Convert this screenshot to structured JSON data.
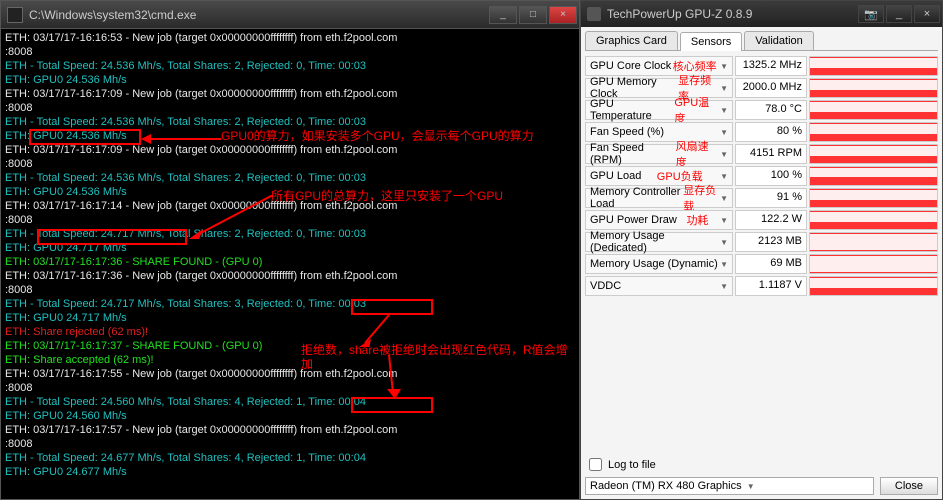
{
  "cmd": {
    "title": "C:\\Windows\\system32\\cmd.exe",
    "btn_min": "_",
    "btn_max": "□",
    "btn_close": "×",
    "lines": [
      {
        "cls": "t-white",
        "txt": "ETH: 03/17/17-16:16:53 - New job (target 0x00000000ffffffff) from eth.f2pool.com"
      },
      {
        "cls": "t-white",
        "txt": ":8008"
      },
      {
        "cls": "t-teal",
        "txt": "ETH - Total Speed: 24.536 Mh/s, Total Shares: 2, Rejected: 0, Time: 00:03"
      },
      {
        "cls": "t-teal",
        "txt": "ETH: GPU0 24.536 Mh/s"
      },
      {
        "cls": "t-white",
        "txt": "ETH: 03/17/17-16:17:09 - New job (target 0x00000000ffffffff) from eth.f2pool.com"
      },
      {
        "cls": "t-white",
        "txt": ":8008"
      },
      {
        "cls": "t-teal",
        "txt": "ETH - Total Speed: 24.536 Mh/s, Total Shares: 2, Rejected: 0, Time: 00:03"
      },
      {
        "cls": "t-teal",
        "txt": "ETH: GPU0 24.536 Mh/s"
      },
      {
        "cls": "t-white",
        "txt": "ETH: 03/17/17-16:17:09 - New job (target 0x00000000ffffffff) from eth.f2pool.com"
      },
      {
        "cls": "t-white",
        "txt": ":8008"
      },
      {
        "cls": "t-teal",
        "txt": "ETH - Total Speed: 24.536 Mh/s, Total Shares: 2, Rejected: 0, Time: 00:03"
      },
      {
        "cls": "t-teal",
        "txt": "ETH: GPU0 24.536 Mh/s"
      },
      {
        "cls": "t-white",
        "txt": "ETH: 03/17/17-16:17:14 - New job (target 0x00000000ffffffff) from eth.f2pool.com"
      },
      {
        "cls": "t-white",
        "txt": ":8008"
      },
      {
        "cls": "t-teal",
        "txt": "ETH - Total Speed: 24.717 Mh/s, Total Shares: 2, Rejected: 0, Time: 00:03"
      },
      {
        "cls": "t-teal",
        "txt": "ETH: GPU0 24.717 Mh/s"
      },
      {
        "cls": "t-green",
        "txt": "ETH: 03/17/17-16:17:36 - SHARE FOUND - (GPU 0)"
      },
      {
        "cls": "t-white",
        "txt": "ETH: 03/17/17-16:17:36 - New job (target 0x00000000ffffffff) from eth.f2pool.com"
      },
      {
        "cls": "t-white",
        "txt": ":8008"
      },
      {
        "cls": "t-teal",
        "txt": "ETH - Total Speed: 24.717 Mh/s, Total Shares: 3, Rejected: 0, Time: 00:03"
      },
      {
        "cls": "t-teal",
        "txt": "ETH: GPU0 24.717 Mh/s"
      },
      {
        "cls": "t-red",
        "txt": "ETH: Share rejected (62 ms)!"
      },
      {
        "cls": "t-green",
        "txt": "ETH: 03/17/17-16:17:37 - SHARE FOUND - (GPU 0)"
      },
      {
        "cls": "t-green",
        "txt": "ETH: Share accepted (62 ms)!"
      },
      {
        "cls": "t-white",
        "txt": "ETH: 03/17/17-16:17:55 - New job (target 0x00000000ffffffff) from eth.f2pool.com"
      },
      {
        "cls": "t-white",
        "txt": ":8008"
      },
      {
        "cls": "t-teal",
        "txt": "ETH - Total Speed: 24.560 Mh/s, Total Shares: 4, Rejected: 1, Time: 00:04"
      },
      {
        "cls": "t-teal",
        "txt": "ETH: GPU0 24.560 Mh/s"
      },
      {
        "cls": "t-white",
        "txt": "ETH: 03/17/17-16:17:57 - New job (target 0x00000000ffffffff) from eth.f2pool.com"
      },
      {
        "cls": "t-white",
        "txt": ":8008"
      },
      {
        "cls": "t-teal",
        "txt": "ETH - Total Speed: 24.677 Mh/s, Total Shares: 4, Rejected: 1, Time: 00:04"
      },
      {
        "cls": "t-teal",
        "txt": "ETH: GPU0 24.677 Mh/s"
      }
    ]
  },
  "annot": {
    "gpu0": "GPU0的算力，如果安装多个GPU，会显示每个GPU的算力",
    "total": "所有GPU的总算力，这里只安装了一个GPU",
    "reject": "拒绝数，share被拒绝时会出现红色代码，R值会增加"
  },
  "gpuz": {
    "title": "TechPowerUp GPU-Z 0.8.9",
    "btn_cam": "📷",
    "btn_min": "_",
    "btn_close": "×",
    "tabs": {
      "card": "Graphics Card",
      "sensors": "Sensors",
      "valid": "Validation"
    },
    "sensors": [
      {
        "label": "GPU Core Clock",
        "anno": "核心频率",
        "val": "1325.2 MHz",
        "g": "mid"
      },
      {
        "label": "GPU Memory Clock",
        "anno": "显存频率",
        "val": "2000.0 MHz",
        "g": "mid"
      },
      {
        "label": "GPU Temperature",
        "anno": "GPU温度",
        "val": "78.0 °C",
        "g": "mid"
      },
      {
        "label": "Fan Speed (%)",
        "anno": "",
        "val": "80 %",
        "g": "mid"
      },
      {
        "label": "Fan Speed (RPM)",
        "anno": "风扇速度",
        "val": "4151 RPM",
        "g": "mid"
      },
      {
        "label": "GPU Load",
        "anno": "GPU负载",
        "val": "100 %",
        "g": ""
      },
      {
        "label": "Memory Controller Load",
        "anno": "显存负载",
        "val": "91 %",
        "g": "mid"
      },
      {
        "label": "GPU Power Draw",
        "anno": "功耗",
        "val": "122.2 W",
        "g": "mid"
      },
      {
        "label": "Memory Usage (Dedicated)",
        "anno": "",
        "val": "2123 MB",
        "g": "low"
      },
      {
        "label": "Memory Usage (Dynamic)",
        "anno": "",
        "val": "69 MB",
        "g": "low"
      },
      {
        "label": "VDDC",
        "anno": "",
        "val": "1.1187 V",
        "g": "mid"
      }
    ],
    "log": "Log to file",
    "gpu": "Radeon (TM) RX 480 Graphics",
    "close": "Close"
  }
}
